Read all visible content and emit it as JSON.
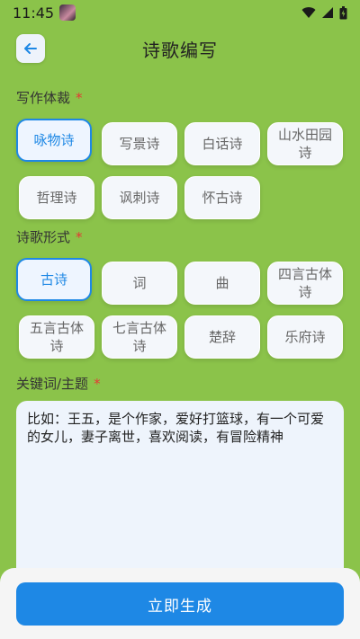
{
  "status": {
    "time": "11:45"
  },
  "header": {
    "title": "诗歌编写"
  },
  "genre": {
    "label": "写作体裁",
    "required_mark": "*",
    "options": [
      "咏物诗",
      "写景诗",
      "白话诗",
      "山水田园诗",
      "哲理诗",
      "讽刺诗",
      "怀古诗"
    ],
    "selected": "咏物诗"
  },
  "form": {
    "label": "诗歌形式",
    "required_mark": "*",
    "options": [
      "古诗",
      "词",
      "曲",
      "四言古体诗",
      "五言古体诗",
      "七言古体诗",
      "楚辞",
      "乐府诗"
    ],
    "selected": "古诗"
  },
  "keywords": {
    "label": "关键词/主题",
    "required_mark": "*",
    "placeholder": "比如：王五，是个作家，爱好打篮球，有一个可爱的女儿，妻子离世，喜欢阅读，有冒险精神"
  },
  "actions": {
    "generate_label": "立即生成"
  },
  "colors": {
    "background": "#8bc34a",
    "accent": "#1e88e5",
    "required": "#e53935"
  }
}
